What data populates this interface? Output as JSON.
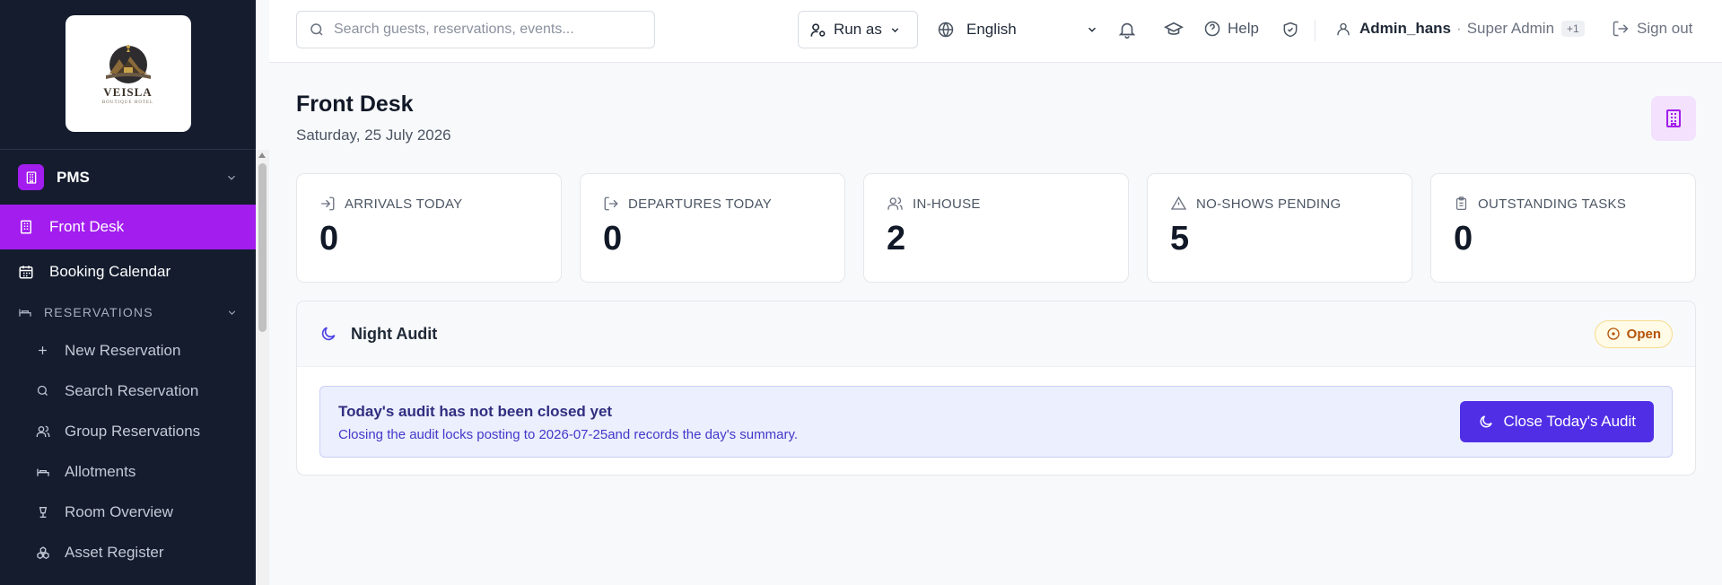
{
  "brand": {
    "logo_text": "VEISLA",
    "logo_sub": "BOUTIQUE HOTEL"
  },
  "sidebar": {
    "module": {
      "label": "PMS",
      "icon": "building-icon"
    },
    "items": [
      {
        "label": "Front Desk",
        "icon": "building-icon",
        "active": true
      },
      {
        "label": "Booking Calendar",
        "icon": "calendar-icon",
        "active": false
      }
    ],
    "section": {
      "label": "RESERVATIONS",
      "icon": "bed-icon"
    },
    "sub_items": [
      {
        "label": "New Reservation",
        "icon": "plus-icon"
      },
      {
        "label": "Search Reservation",
        "icon": "search-icon"
      },
      {
        "label": "Group Reservations",
        "icon": "users-icon"
      },
      {
        "label": "Allotments",
        "icon": "bed-icon"
      },
      {
        "label": "Room Overview",
        "icon": "lamp-icon"
      },
      {
        "label": "Asset Register",
        "icon": "boxes-icon"
      }
    ]
  },
  "topbar": {
    "search_placeholder": "Search guests, reservations, events...",
    "run_as": "Run as",
    "language": "English",
    "help": "Help",
    "user_name": "Admin_hans",
    "separator": "·",
    "role": "Super Admin",
    "extra_roles": "+1",
    "sign_out": "Sign out"
  },
  "page": {
    "title": "Front Desk",
    "date": "Saturday, 25 July 2026"
  },
  "stats": [
    {
      "label": "ARRIVALS TODAY",
      "value": "0",
      "icon": "log-in-icon"
    },
    {
      "label": "DEPARTURES TODAY",
      "value": "0",
      "icon": "log-out-icon"
    },
    {
      "label": "IN-HOUSE",
      "value": "2",
      "icon": "users-icon"
    },
    {
      "label": "NO-SHOWS PENDING",
      "value": "5",
      "icon": "alert-triangle-icon"
    },
    {
      "label": "OUTSTANDING TASKS",
      "value": "0",
      "icon": "clipboard-icon"
    }
  ],
  "night_audit": {
    "title": "Night Audit",
    "status": "Open",
    "alert_title": "Today's audit has not been closed yet",
    "alert_desc": "Closing the audit locks posting to 2026-07-25and records the day's summary.",
    "button": "Close Today's Audit"
  },
  "colors": {
    "sidebar_bg": "#141c2e",
    "accent": "#a21dee",
    "primary_button": "#4f2ee6",
    "status_open": "#b45309"
  }
}
